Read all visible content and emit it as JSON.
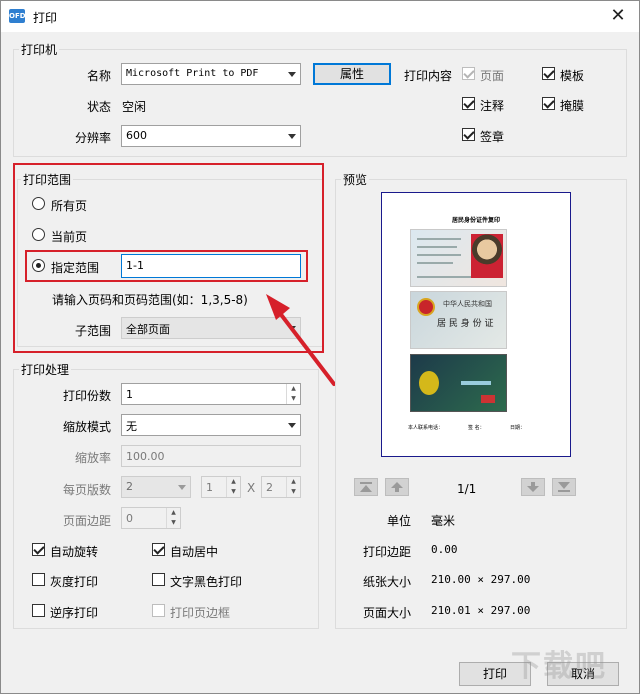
{
  "window": {
    "icon": "OFD",
    "title": "打印",
    "close": "✕"
  },
  "printer": {
    "legend": "打印机",
    "name_label": "名称",
    "name_value": "Microsoft Print to PDF",
    "properties_button": "属性",
    "status_label": "状态",
    "status_value": "空闲",
    "resolution_label": "分辨率",
    "resolution_value": "600",
    "content_label": "打印内容",
    "content_options": [
      {
        "label": "页面",
        "checked": true,
        "enabled": false
      },
      {
        "label": "模板",
        "checked": true,
        "enabled": true
      },
      {
        "label": "注释",
        "checked": true,
        "enabled": true
      },
      {
        "label": "掩膜",
        "checked": true,
        "enabled": true
      },
      {
        "label": "签章",
        "checked": true,
        "enabled": true
      }
    ]
  },
  "range": {
    "legend": "打印范围",
    "all_pages": "所有页",
    "current_page": "当前页",
    "specified": "指定范围",
    "specified_value": "1-1",
    "hint": "请输入页码和页码范围(如：1,3,5-8)",
    "subrange_label": "子范围",
    "subrange_value": "全部页面"
  },
  "processing": {
    "legend": "打印处理",
    "copies_label": "打印份数",
    "copies_value": "1",
    "scale_mode_label": "缩放模式",
    "scale_mode_value": "无",
    "scale_label": "缩放率",
    "scale_value": "100.00",
    "pages_per_sheet_label": "每页版数",
    "pages_per_sheet_value": "2",
    "grid_cols": "1",
    "grid_x": "X",
    "grid_rows": "2",
    "margin_label": "页面边距",
    "margin_value": "0",
    "options": [
      {
        "label": "自动旋转",
        "checked": true,
        "enabled": true
      },
      {
        "label": "自动居中",
        "checked": true,
        "enabled": true
      },
      {
        "label": "灰度打印",
        "checked": false,
        "enabled": true
      },
      {
        "label": "文字黑色打印",
        "checked": false,
        "enabled": true
      },
      {
        "label": "逆序打印",
        "checked": false,
        "enabled": true
      },
      {
        "label": "打印页边框",
        "checked": false,
        "enabled": false
      }
    ]
  },
  "preview": {
    "legend": "预览",
    "page_title": "居民身份证件复印",
    "card_front_line1": "中华人民共和国",
    "card_front_line2": "居 民 身 份 证",
    "footer_left": "本人联系电话：",
    "footer_mid": "签 名：",
    "footer_right": "日期：",
    "page_indicator": "1/1",
    "unit_label": "单位",
    "unit_value": "毫米",
    "margin_label": "打印边距",
    "margin_value": "0.00",
    "paper_label": "纸张大小",
    "paper_value": "210.00 × 297.00",
    "page_label": "页面大小",
    "page_value": "210.01 × 297.00"
  },
  "buttons": {
    "print": "打印",
    "cancel": "取消"
  },
  "watermark": "下载吧",
  "colors": {
    "highlight": "#d6202a",
    "preview_border": "#1a1a8c"
  }
}
